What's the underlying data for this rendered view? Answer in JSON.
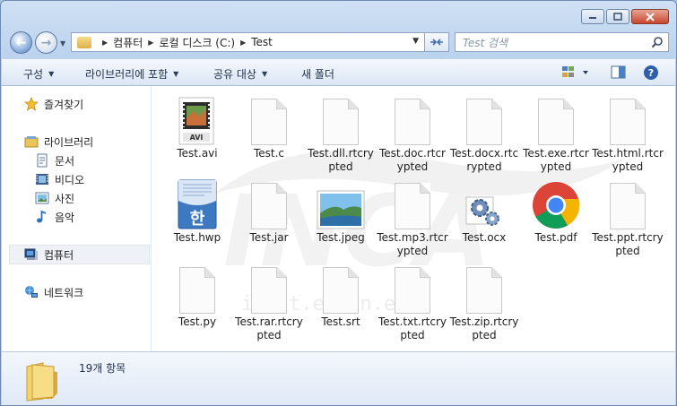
{
  "address": {
    "crumbs": [
      "컴퓨터",
      "로컬 디스크 (C:)",
      "Test"
    ]
  },
  "search": {
    "placeholder": "Test 검색"
  },
  "toolbar": {
    "organize": "구성",
    "library": "라이브러리에 포함",
    "share": "공유 대상",
    "new_folder": "새 폴더"
  },
  "nav": {
    "favorites": "즐겨찾기",
    "libraries": "라이브러리",
    "documents": "문서",
    "videos": "비디오",
    "pictures": "사진",
    "music": "음악",
    "computer": "컴퓨터",
    "network": "네트워크"
  },
  "files": [
    {
      "name": "Test.avi",
      "icon": "avi-video-icon"
    },
    {
      "name": "Test.c",
      "icon": "blank-file-icon"
    },
    {
      "name": "Test.dll.rtcrypted",
      "icon": "blank-file-icon"
    },
    {
      "name": "Test.doc.rtcrypted",
      "icon": "blank-file-icon"
    },
    {
      "name": "Test.docx.rtcrypted",
      "icon": "blank-file-icon"
    },
    {
      "name": "Test.exe.rtcrypted",
      "icon": "blank-file-icon"
    },
    {
      "name": "Test.html.rtcrypted",
      "icon": "blank-file-icon"
    },
    {
      "name": "Test.hwp",
      "icon": "hwp-document-icon"
    },
    {
      "name": "Test.jar",
      "icon": "blank-file-icon"
    },
    {
      "name": "Test.jpeg",
      "icon": "jpeg-image-icon"
    },
    {
      "name": "Test.mp3.rtcrypted",
      "icon": "blank-file-icon"
    },
    {
      "name": "Test.ocx",
      "icon": "gear-settings-icon"
    },
    {
      "name": "Test.pdf",
      "icon": "chrome-icon"
    },
    {
      "name": "Test.ppt.rtcrypted",
      "icon": "blank-file-icon"
    },
    {
      "name": "Test.py",
      "icon": "blank-file-icon"
    },
    {
      "name": "Test.rar.rtcrypted",
      "icon": "blank-file-icon"
    },
    {
      "name": "Test.srt",
      "icon": "blank-file-icon"
    },
    {
      "name": "Test.txt.rtcrypted",
      "icon": "blank-file-icon"
    },
    {
      "name": "Test.zip.rtcrypted",
      "icon": "blank-file-icon"
    }
  ],
  "status": {
    "count": "19개 항목"
  },
  "watermark": "i.n.t.e.r.n.e.t",
  "colors": {
    "accent": "#3f6fb0",
    "selected_nav": "#eef1f5"
  }
}
